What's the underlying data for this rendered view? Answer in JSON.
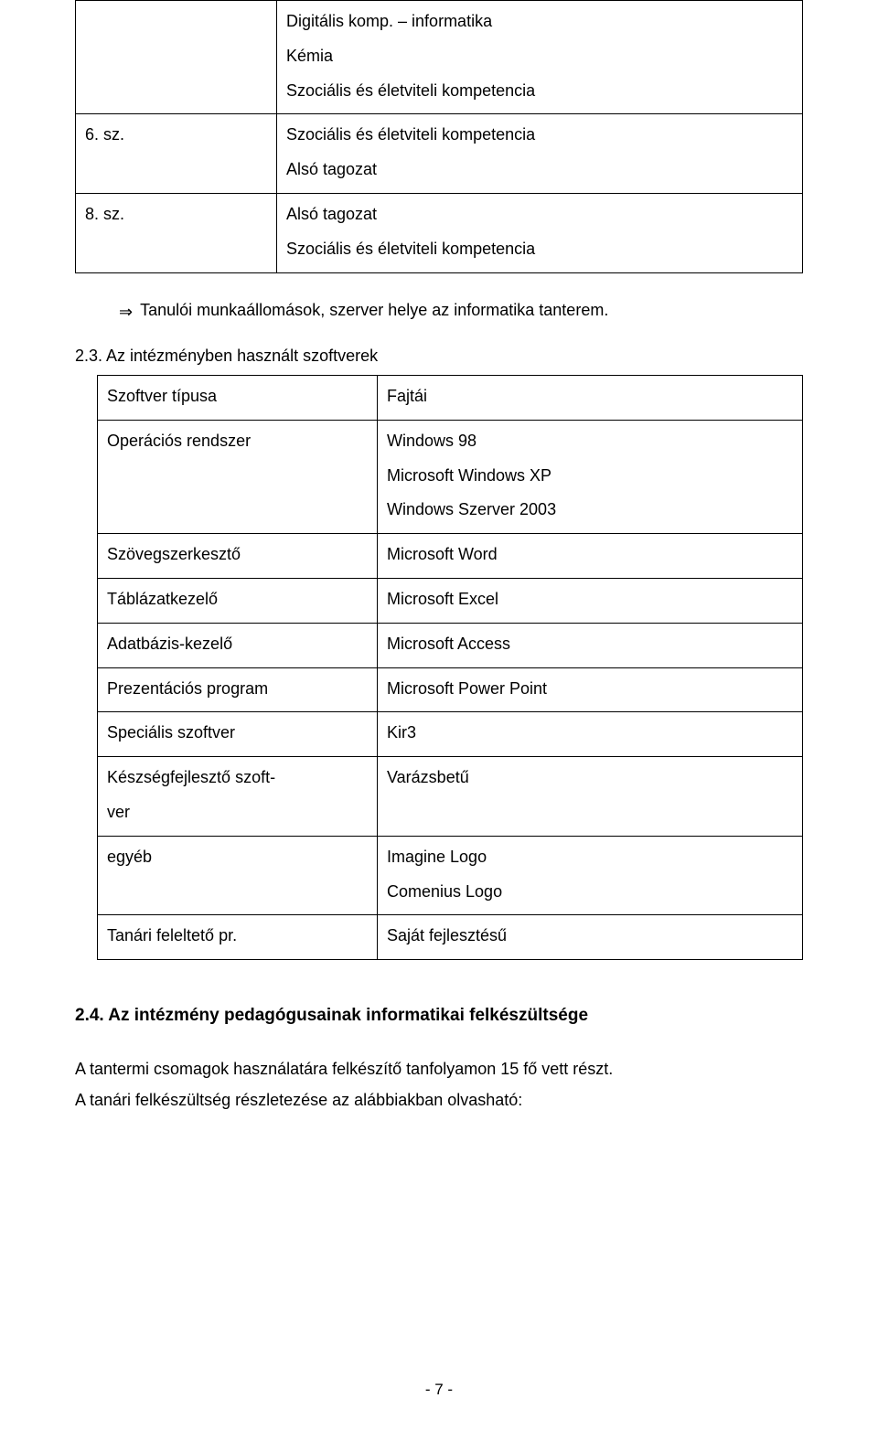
{
  "table1": {
    "row0": {
      "left": "",
      "line1": "Digitális komp. – informatika",
      "line2": "Kémia",
      "line3": "Szociális és életviteli kompetencia"
    },
    "row1": {
      "left": "6. sz.",
      "line1": "Szociális és életviteli kompetencia",
      "line2": "Alsó tagozat"
    },
    "row2": {
      "left": "8. sz.",
      "line1": "Alsó tagozat",
      "line2": "Szociális és életviteli kompetencia"
    }
  },
  "arrow_glyph": "⇒",
  "arrow_text": "Tanulói munkaállomások, szerver helye az informatika tanterem.",
  "sec23_label": "2.3. Az intézményben használt szoftverek",
  "table2": {
    "r0": {
      "c0": "Szoftver típusa",
      "c1": "Fajtái"
    },
    "r1": {
      "c0": "Operációs rendszer",
      "c1a": "Windows 98",
      "c1b": "Microsoft Windows XP",
      "c1c": "Windows Szerver 2003"
    },
    "r2": {
      "c0": "Szövegszerkesztő",
      "c1": "Microsoft Word"
    },
    "r3": {
      "c0": "Táblázatkezelő",
      "c1": "Microsoft Excel"
    },
    "r4": {
      "c0": "Adatbázis-kezelő",
      "c1": "Microsoft Access"
    },
    "r5": {
      "c0": "Prezentációs program",
      "c1": "Microsoft Power Point"
    },
    "r6": {
      "c0": "Speciális szoftver",
      "c1": "Kir3"
    },
    "r7": {
      "c0a": "Készségfejlesztő szoft-",
      "c0b": "ver",
      "c1": "Varázsbetű"
    },
    "r8": {
      "c0": "egyéb",
      "c1a": "Imagine Logo",
      "c1b": "Comenius Logo"
    },
    "r9": {
      "c0": "Tanári feleltető pr.",
      "c1": "Saját fejlesztésű"
    }
  },
  "sec24_heading": "2.4. Az intézmény pedagógusainak informatikai felkészültsége",
  "body1": "A tantermi csomagok használatára felkészítő tanfolyamon 15 fő vett részt.",
  "body2": "A tanári felkészültség részletezése az alábbiakban olvasható:",
  "pagenum": "- 7 -"
}
